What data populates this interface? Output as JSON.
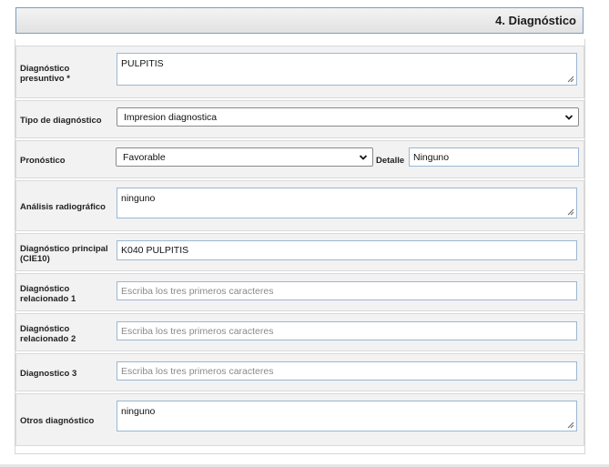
{
  "section": {
    "title": "4. Diagnóstico"
  },
  "fields": {
    "presuntivo": {
      "label": "Diagnóstico presuntivo *",
      "value": "PULPITIS"
    },
    "tipo": {
      "label": "Tipo de diagnóstico",
      "selected": "Impresion diagnostica"
    },
    "pronostico": {
      "label": "Pronóstico",
      "selected": "Favorable",
      "detalle_label": "Detalle",
      "detalle_value": "Ninguno"
    },
    "radiografico": {
      "label": "Análisis radiográfico",
      "value": "ninguno"
    },
    "principal": {
      "label": "Diagnóstico principal (CIE10)",
      "value": "K040 PULPITIS"
    },
    "relacionado1": {
      "label": "Diagnóstico relacionado 1",
      "placeholder": "Escriba los tres primeros caracteres"
    },
    "relacionado2": {
      "label": "Diagnóstico relacionado 2",
      "placeholder": "Escriba los tres primeros caracteres"
    },
    "diagnostico3": {
      "label": "Diagnostico 3",
      "placeholder": "Escriba los tres primeros caracteres"
    },
    "otros": {
      "label": "Otros diagnóstico",
      "value": "ninguno"
    }
  }
}
